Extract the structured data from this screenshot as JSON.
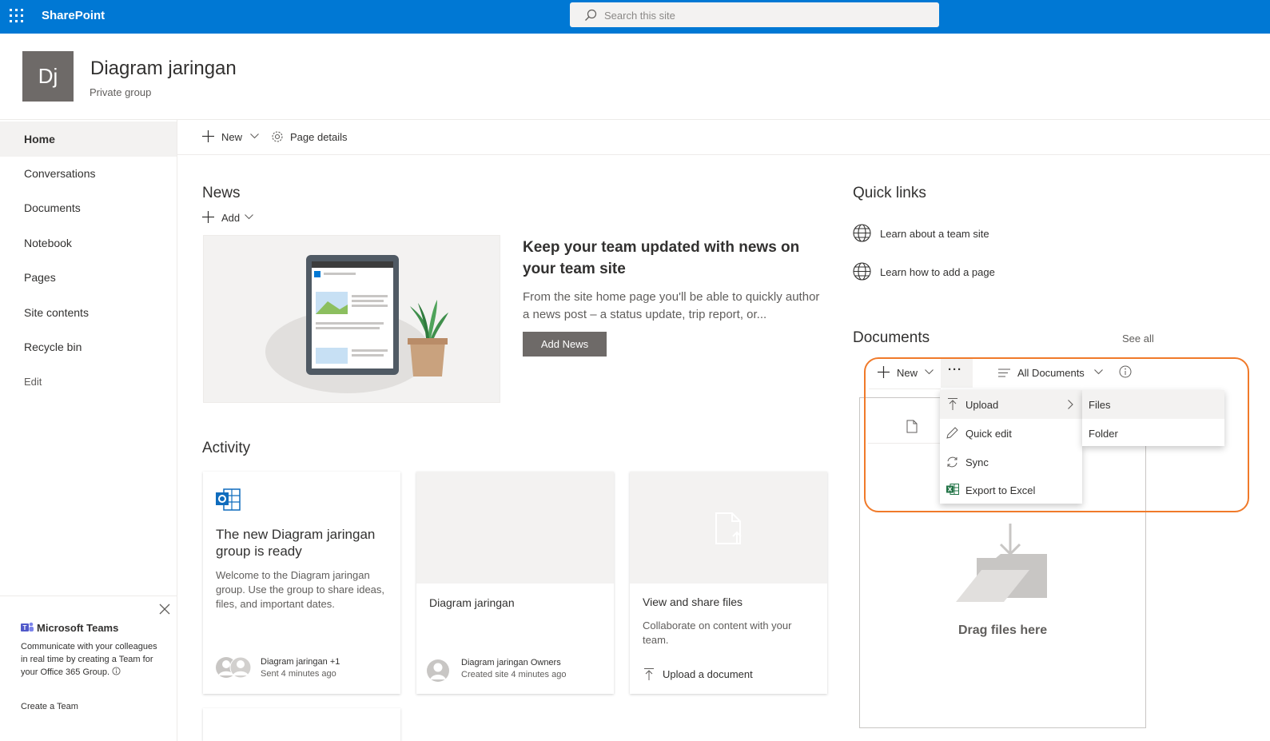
{
  "topbar": {
    "brand": "SharePoint",
    "search_placeholder": "Search this site",
    "accent_color": "#0078d4"
  },
  "site": {
    "logo_initials": "Dj",
    "title": "Diagram jaringan",
    "subtitle": "Private group"
  },
  "nav": {
    "items": [
      {
        "label": "Home"
      },
      {
        "label": "Conversations"
      },
      {
        "label": "Documents"
      },
      {
        "label": "Notebook"
      },
      {
        "label": "Pages"
      },
      {
        "label": "Site contents"
      },
      {
        "label": "Recycle bin"
      },
      {
        "label": "Edit"
      }
    ]
  },
  "teams_promo": {
    "title": "Microsoft Teams",
    "description": "Communicate with your colleagues in real time by creating a Team for your Office 365 Group.",
    "create_label": "Create a Team"
  },
  "commandbar": {
    "new_label": "New",
    "page_details_label": "Page details"
  },
  "news": {
    "title": "News",
    "add_label": "Add",
    "headline": "Keep your team updated with news on your team site",
    "body": "From the site home page you'll be able to quickly author a news post – a status update, trip report, or...",
    "add_news_button": "Add News"
  },
  "activity": {
    "title": "Activity",
    "cards": [
      {
        "title": "The new Diagram jaringan group is ready",
        "description": "Welcome to the Diagram jaringan group. Use the group to share ideas, files, and important dates.",
        "author": "Diagram jaringan +1",
        "time": "Sent 4 minutes ago"
      },
      {
        "title": "Diagram jaringan",
        "author": "Diagram jaringan Owners",
        "time": "Created site 4 minutes ago"
      },
      {
        "title": "View and share files",
        "description": "Collaborate on content with your team.",
        "action": "Upload a document"
      }
    ]
  },
  "quick_links": {
    "title": "Quick links",
    "items": [
      {
        "label": "Learn about a team site"
      },
      {
        "label": "Learn how to add a page"
      }
    ]
  },
  "documents": {
    "title": "Documents",
    "see_all": "See all",
    "new_label": "New",
    "more_label": "···",
    "view_label": "All Documents",
    "drag_label": "Drag files here",
    "menu": [
      {
        "label": "Upload"
      },
      {
        "label": "Quick edit"
      },
      {
        "label": "Sync"
      },
      {
        "label": "Export to Excel"
      }
    ],
    "submenu": [
      {
        "label": "Files"
      },
      {
        "label": "Folder"
      }
    ]
  },
  "colors": {
    "highlight": "#f07a2a",
    "excel_green": "#217346",
    "outlook_blue": "#0f6cbd"
  }
}
